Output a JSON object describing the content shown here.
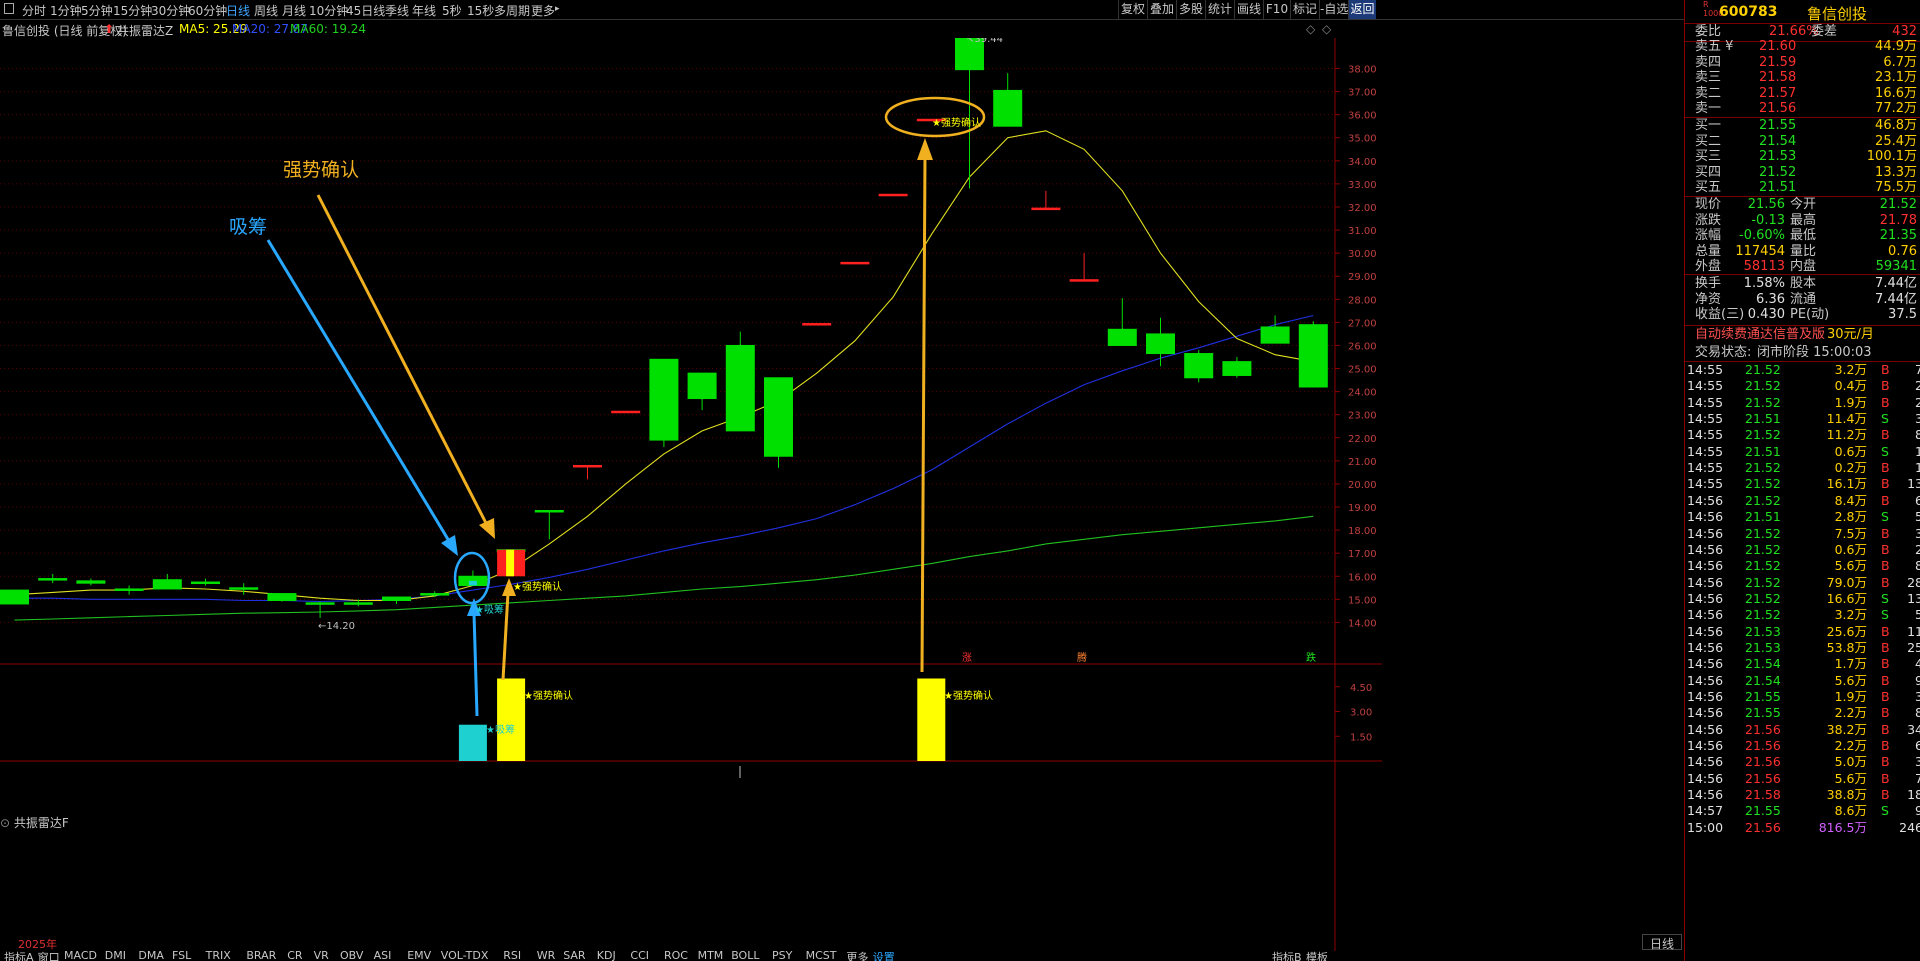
{
  "toolbar": {
    "periods": [
      "分时",
      "1分钟",
      "5分钟",
      "15分钟",
      "30分钟",
      "60分钟",
      "日线",
      "周线",
      "月线",
      "10分钟",
      "45日线",
      "季线",
      "年线",
      "5秒",
      "15秒",
      "多周期",
      "更多"
    ],
    "active_period": "日线",
    "right_buttons": [
      "复权",
      "叠加",
      "多股",
      "统计",
      "画线",
      "F10",
      "标记",
      "-自选",
      "返回"
    ]
  },
  "info": {
    "stock_title": "鲁信创投 (日线 前复权)",
    "indicator_name": "共振雷达Z",
    "ma5": "MA5: 25.29",
    "ma20": "MA20: 27.87",
    "ma60": "MA60: 19.24"
  },
  "sub_panel": {
    "title": "共振雷达F",
    "y_ticks": [
      "4.50",
      "3.00",
      "1.50"
    ]
  },
  "bottom_tabs": [
    "指标A",
    "窗口",
    "MACD",
    "DMI",
    "DMA",
    "FSL",
    "TRIX",
    "BRAR",
    "CR",
    "VR",
    "OBV",
    "ASI",
    "EMV",
    "VOL-TDX",
    "RSI",
    "WR",
    "SAR",
    "KDJ",
    "CCI",
    "ROC",
    "MTM",
    "BOLL",
    "PSY",
    "MCST",
    "更多",
    "设置"
  ],
  "bottom_right_tabs": [
    "指标B",
    "模板"
  ],
  "year_label": "2025年",
  "period_label": "日线",
  "annotations": {
    "xichou_label": "吸筹",
    "qiangshi_label": "强势确认",
    "marker_qiangshi": "★强势确认",
    "marker_xichou": "★吸筹",
    "high_label": "39.44",
    "low_label": "14.20",
    "zhang": "涨",
    "die": "跌",
    "teng": "腾"
  },
  "chart_data": {
    "type": "candlestick",
    "y_axis_ticks": [
      "38.00",
      "37.00",
      "36.00",
      "35.00",
      "34.00",
      "33.00",
      "32.00",
      "31.00",
      "30.00",
      "29.00",
      "28.00",
      "27.00",
      "26.00",
      "25.00",
      "24.00",
      "23.00",
      "22.00",
      "21.00",
      "20.00",
      "19.00",
      "18.00",
      "17.00",
      "16.00",
      "15.00",
      "14.00"
    ],
    "ylim": [
      13.5,
      38.8
    ],
    "candles": [
      {
        "o": 15.4,
        "c": 14.8,
        "h": 15.4,
        "l": 14.8
      },
      {
        "o": 15.9,
        "c": 15.85,
        "h": 16.1,
        "l": 15.7
      },
      {
        "o": 15.8,
        "c": 15.7,
        "h": 15.9,
        "l": 15.6
      },
      {
        "o": 15.45,
        "c": 15.4,
        "h": 15.6,
        "l": 15.2
      },
      {
        "o": 15.85,
        "c": 15.45,
        "h": 16.1,
        "l": 15.45
      },
      {
        "o": 15.75,
        "c": 15.7,
        "h": 15.9,
        "l": 15.6
      },
      {
        "o": 15.5,
        "c": 15.45,
        "h": 15.7,
        "l": 15.2
      },
      {
        "o": 15.25,
        "c": 14.95,
        "h": 15.25,
        "l": 14.9
      },
      {
        "o": 14.85,
        "c": 14.8,
        "h": 14.9,
        "l": 14.2
      },
      {
        "o": 14.85,
        "c": 14.8,
        "h": 15.0,
        "l": 14.7
      },
      {
        "o": 15.1,
        "c": 14.95,
        "h": 15.1,
        "l": 14.8
      },
      {
        "o": 15.25,
        "c": 15.2,
        "h": 15.35,
        "l": 15.1
      },
      {
        "o": 16.0,
        "c": 15.6,
        "h": 16.25,
        "l": 15.6
      },
      {
        "o": 17.15,
        "c": 17.1,
        "h": 17.15,
        "l": 16.0
      },
      {
        "o": 18.85,
        "c": 18.8,
        "h": 18.85,
        "l": 17.6
      },
      {
        "o": 20.8,
        "c": 20.8,
        "h": 20.8,
        "l": 20.2
      },
      {
        "o": 23.15,
        "c": 23.15,
        "h": 23.15,
        "l": 23.15
      },
      {
        "o": 25.4,
        "c": 21.9,
        "h": 25.4,
        "l": 21.6
      },
      {
        "o": 24.8,
        "c": 23.7,
        "h": 24.8,
        "l": 23.2
      },
      {
        "o": 26.0,
        "c": 22.3,
        "h": 26.6,
        "l": 22.3
      },
      {
        "o": 24.6,
        "c": 21.2,
        "h": 24.6,
        "l": 20.7
      },
      {
        "o": 26.95,
        "c": 26.95,
        "h": 26.95,
        "l": 26.95
      },
      {
        "o": 29.6,
        "c": 29.6,
        "h": 29.6,
        "l": 29.6
      },
      {
        "o": 32.55,
        "c": 32.55,
        "h": 32.55,
        "l": 32.55
      },
      {
        "o": 35.8,
        "c": 35.8,
        "h": 35.8,
        "l": 35.8
      },
      {
        "o": 39.44,
        "c": 37.95,
        "h": 39.44,
        "l": 32.8
      },
      {
        "o": 37.05,
        "c": 35.5,
        "h": 37.8,
        "l": 35.5
      },
      {
        "o": 31.95,
        "c": 31.95,
        "h": 32.7,
        "l": 31.95
      },
      {
        "o": 28.85,
        "c": 28.85,
        "h": 30.0,
        "l": 28.85
      },
      {
        "o": 26.7,
        "c": 26.0,
        "h": 28.05,
        "l": 26.0
      },
      {
        "o": 26.5,
        "c": 25.65,
        "h": 27.2,
        "l": 25.1
      },
      {
        "o": 25.65,
        "c": 24.6,
        "h": 25.8,
        "l": 24.4
      },
      {
        "o": 25.3,
        "c": 24.7,
        "h": 25.5,
        "l": 24.6
      },
      {
        "o": 26.8,
        "c": 26.1,
        "h": 27.3,
        "l": 26.1
      },
      {
        "o": 26.9,
        "c": 24.2,
        "h": 27.05,
        "l": 24.2
      }
    ],
    "ma5": [
      15.2,
      15.3,
      15.4,
      15.4,
      15.5,
      15.45,
      15.35,
      15.2,
      15.05,
      14.95,
      14.95,
      15.15,
      15.6,
      16.3,
      17.4,
      18.6,
      20.0,
      21.3,
      22.3,
      22.9,
      23.6,
      24.8,
      26.2,
      28.1,
      30.8,
      33.3,
      35.0,
      35.3,
      34.5,
      32.7,
      30.0,
      27.9,
      26.3,
      25.6,
      25.3
    ],
    "ma20": [
      15.05,
      15.05,
      15.0,
      15.0,
      15.0,
      15.0,
      14.95,
      14.95,
      14.9,
      14.95,
      15.0,
      15.15,
      15.4,
      15.65,
      15.95,
      16.3,
      16.7,
      17.1,
      17.45,
      17.75,
      18.1,
      18.5,
      19.1,
      19.8,
      20.6,
      21.6,
      22.6,
      23.5,
      24.3,
      24.9,
      25.45,
      25.9,
      26.4,
      26.9,
      27.3
    ],
    "ma60": [
      14.1,
      14.15,
      14.2,
      14.25,
      14.3,
      14.35,
      14.4,
      14.42,
      14.45,
      14.5,
      14.55,
      14.65,
      14.75,
      14.85,
      14.95,
      15.05,
      15.15,
      15.3,
      15.45,
      15.55,
      15.7,
      15.85,
      16.05,
      16.3,
      16.55,
      16.85,
      17.1,
      17.4,
      17.6,
      17.8,
      17.95,
      18.1,
      18.25,
      18.4,
      18.6
    ],
    "sub_bars": [
      {
        "index": 12,
        "value": 2.2,
        "color": "#1fd0d0"
      },
      {
        "index": 13,
        "value": 5.0,
        "color": "#ffff00"
      },
      {
        "index": 24,
        "value": 5.0,
        "color": "#ffff00"
      }
    ],
    "sub_ylim": [
      0,
      5.8
    ]
  },
  "quote": {
    "code": "600783",
    "name": "鲁信创投",
    "tag": "R\n1000",
    "weibi_label": "委比",
    "weibi": "21.66%",
    "weicha_label": "委差",
    "weicha": "432",
    "asks": [
      {
        "label": "卖五 ¥",
        "price": "21.60",
        "vol": "44.9万"
      },
      {
        "label": "卖四",
        "price": "21.59",
        "vol": "6.7万"
      },
      {
        "label": "卖三",
        "price": "21.58",
        "vol": "23.1万"
      },
      {
        "label": "卖二",
        "price": "21.57",
        "vol": "16.6万"
      },
      {
        "label": "卖一",
        "price": "21.56",
        "vol": "77.2万"
      }
    ],
    "bids": [
      {
        "label": "买一",
        "price": "21.55",
        "vol": "46.8万"
      },
      {
        "label": "买二",
        "price": "21.54",
        "vol": "25.4万"
      },
      {
        "label": "买三",
        "price": "21.53",
        "vol": "100.1万"
      },
      {
        "label": "买四",
        "price": "21.52",
        "vol": "13.3万"
      },
      {
        "label": "买五",
        "price": "21.51",
        "vol": "75.5万"
      }
    ],
    "stats": [
      {
        "l1": "现价",
        "v1": "21.56",
        "c1": "green",
        "l2": "今开",
        "v2": "21.52",
        "c2": "green"
      },
      {
        "l1": "涨跌",
        "v1": "-0.13",
        "c1": "green",
        "l2": "最高",
        "v2": "21.78",
        "c2": "red"
      },
      {
        "l1": "涨幅",
        "v1": "-0.60%",
        "c1": "green",
        "l2": "最低",
        "v2": "21.35",
        "c2": "green"
      },
      {
        "l1": "总量",
        "v1": "117454",
        "c1": "yellow",
        "l2": "量比",
        "v2": "0.76",
        "c2": "yellow"
      },
      {
        "l1": "外盘",
        "v1": "58113",
        "c1": "red",
        "l2": "内盘",
        "v2": "59341",
        "c2": "green"
      }
    ],
    "stats2": [
      {
        "l1": "换手",
        "v1": "1.58%",
        "l2": "股本",
        "v2": "7.44亿"
      },
      {
        "l1": "净资",
        "v1": "6.36",
        "l2": "流通",
        "v2": "7.44亿"
      },
      {
        "l1": "收益(三)",
        "v1": "0.430",
        "l2": "PE(动)",
        "v2": "37.5"
      }
    ],
    "promo": "自动续费通达信普及版",
    "promo_price": "30元/月",
    "status_label": "交易状态:",
    "status_value": "闭市阶段 15:00:03",
    "ticks": [
      {
        "t": "14:55",
        "p": "21.52",
        "v": "3.2万",
        "s": "B",
        "n": "7"
      },
      {
        "t": "14:55",
        "p": "21.52",
        "v": "0.4万",
        "s": "B",
        "n": "2"
      },
      {
        "t": "14:55",
        "p": "21.52",
        "v": "1.9万",
        "s": "B",
        "n": "2"
      },
      {
        "t": "14:55",
        "p": "21.51",
        "v": "11.4万",
        "s": "S",
        "n": "3"
      },
      {
        "t": "14:55",
        "p": "21.52",
        "v": "11.2万",
        "s": "B",
        "n": "8"
      },
      {
        "t": "14:55",
        "p": "21.51",
        "v": "0.6万",
        "s": "S",
        "n": "1"
      },
      {
        "t": "14:55",
        "p": "21.52",
        "v": "0.2万",
        "s": "B",
        "n": "1"
      },
      {
        "t": "14:55",
        "p": "21.52",
        "v": "16.1万",
        "s": "B",
        "n": "13"
      },
      {
        "t": "14:56",
        "p": "21.52",
        "v": "8.4万",
        "s": "B",
        "n": "6"
      },
      {
        "t": "14:56",
        "p": "21.51",
        "v": "2.8万",
        "s": "S",
        "n": "5"
      },
      {
        "t": "14:56",
        "p": "21.52",
        "v": "7.5万",
        "s": "B",
        "n": "3"
      },
      {
        "t": "14:56",
        "p": "21.52",
        "v": "0.6万",
        "s": "B",
        "n": "2"
      },
      {
        "t": "14:56",
        "p": "21.52",
        "v": "5.6万",
        "s": "B",
        "n": "8"
      },
      {
        "t": "14:56",
        "p": "21.52",
        "v": "79.0万",
        "s": "B",
        "n": "28"
      },
      {
        "t": "14:56",
        "p": "21.52",
        "v": "16.6万",
        "s": "S",
        "n": "13"
      },
      {
        "t": "14:56",
        "p": "21.52",
        "v": "3.2万",
        "s": "S",
        "n": "5"
      },
      {
        "t": "14:56",
        "p": "21.53",
        "v": "25.6万",
        "s": "B",
        "n": "11"
      },
      {
        "t": "14:56",
        "p": "21.53",
        "v": "53.8万",
        "s": "B",
        "n": "25"
      },
      {
        "t": "14:56",
        "p": "21.54",
        "v": "1.7万",
        "s": "B",
        "n": "4"
      },
      {
        "t": "14:56",
        "p": "21.54",
        "v": "5.6万",
        "s": "B",
        "n": "9"
      },
      {
        "t": "14:56",
        "p": "21.55",
        "v": "1.9万",
        "s": "B",
        "n": "3"
      },
      {
        "t": "14:56",
        "p": "21.55",
        "v": "2.2万",
        "s": "B",
        "n": "8"
      },
      {
        "t": "14:56",
        "p": "21.56",
        "v": "38.2万",
        "s": "B",
        "n": "34"
      },
      {
        "t": "14:56",
        "p": "21.56",
        "v": "2.2万",
        "s": "B",
        "n": "6"
      },
      {
        "t": "14:56",
        "p": "21.56",
        "v": "5.0万",
        "s": "B",
        "n": "3"
      },
      {
        "t": "14:56",
        "p": "21.56",
        "v": "5.6万",
        "s": "B",
        "n": "7"
      },
      {
        "t": "14:56",
        "p": "21.58",
        "v": "38.8万",
        "s": "B",
        "n": "18"
      },
      {
        "t": "14:57",
        "p": "21.55",
        "v": "8.6万",
        "s": "S",
        "n": "9"
      },
      {
        "t": "15:00",
        "p": "21.56",
        "v": "816.5万",
        "s": "",
        "n": "246"
      }
    ]
  }
}
